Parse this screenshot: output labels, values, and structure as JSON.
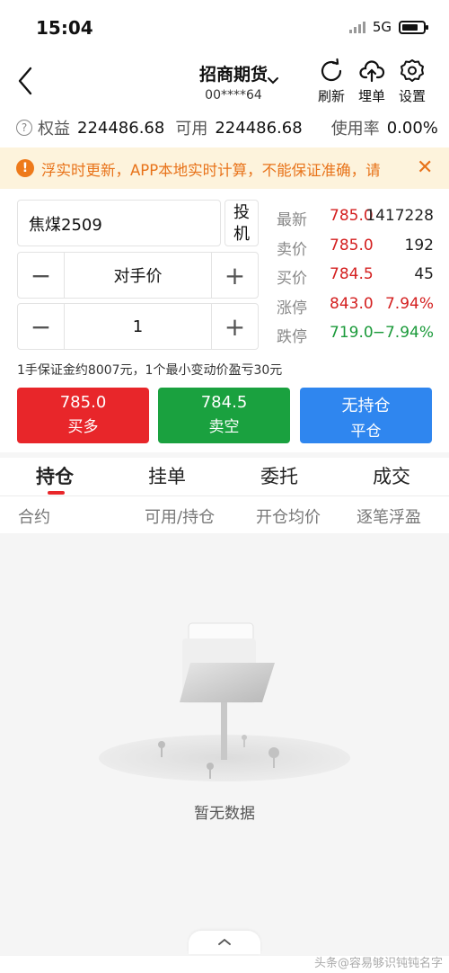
{
  "status_bar": {
    "time": "15:04",
    "network": "5G"
  },
  "header": {
    "title": "招商期货",
    "account": "00****64",
    "refresh_label": "刷新",
    "cloud_order_label": "埋单",
    "settings_label": "设置"
  },
  "account_summary": {
    "equity_label": "权益",
    "equity_value": "224486.68",
    "available_label": "可用",
    "available_value": "224486.68",
    "usage_label": "使用率",
    "usage_value": "0.00%"
  },
  "notice": {
    "text": "浮实时更新，APP本地实时计算，不能保证准确，请"
  },
  "order_form": {
    "contract": "焦煤2509",
    "speculation_label": "投\n机",
    "price_type": "对手价",
    "quantity": "1",
    "margin_info": "1手保证金约8007元，1个最小变动价盈亏30元"
  },
  "quotes": [
    {
      "label": "最新",
      "price": "785.0",
      "volume": "1417228",
      "color": "red"
    },
    {
      "label": "卖价",
      "price": "785.0",
      "volume": "192",
      "color": "red"
    },
    {
      "label": "买价",
      "price": "784.5",
      "volume": "45",
      "color": "red"
    },
    {
      "label": "涨停",
      "price": "843.0",
      "volume": "7.94%",
      "color": "red"
    },
    {
      "label": "跌停",
      "price": "719.0",
      "volume": "−7.94%",
      "color": "green"
    }
  ],
  "actions": {
    "buy_price": "785.0",
    "buy_label": "买多",
    "sell_price": "784.5",
    "sell_label": "卖空",
    "close_status": "无持仓",
    "close_label": "平仓"
  },
  "tabs": [
    "持仓",
    "挂单",
    "委托",
    "成交"
  ],
  "active_tab": 0,
  "columns": [
    "合约",
    "可用/持仓",
    "开仓均价",
    "逐笔浮盈"
  ],
  "empty_state": {
    "text": "暂无数据"
  },
  "watermark": "头条@容易够识钝钝名字"
}
